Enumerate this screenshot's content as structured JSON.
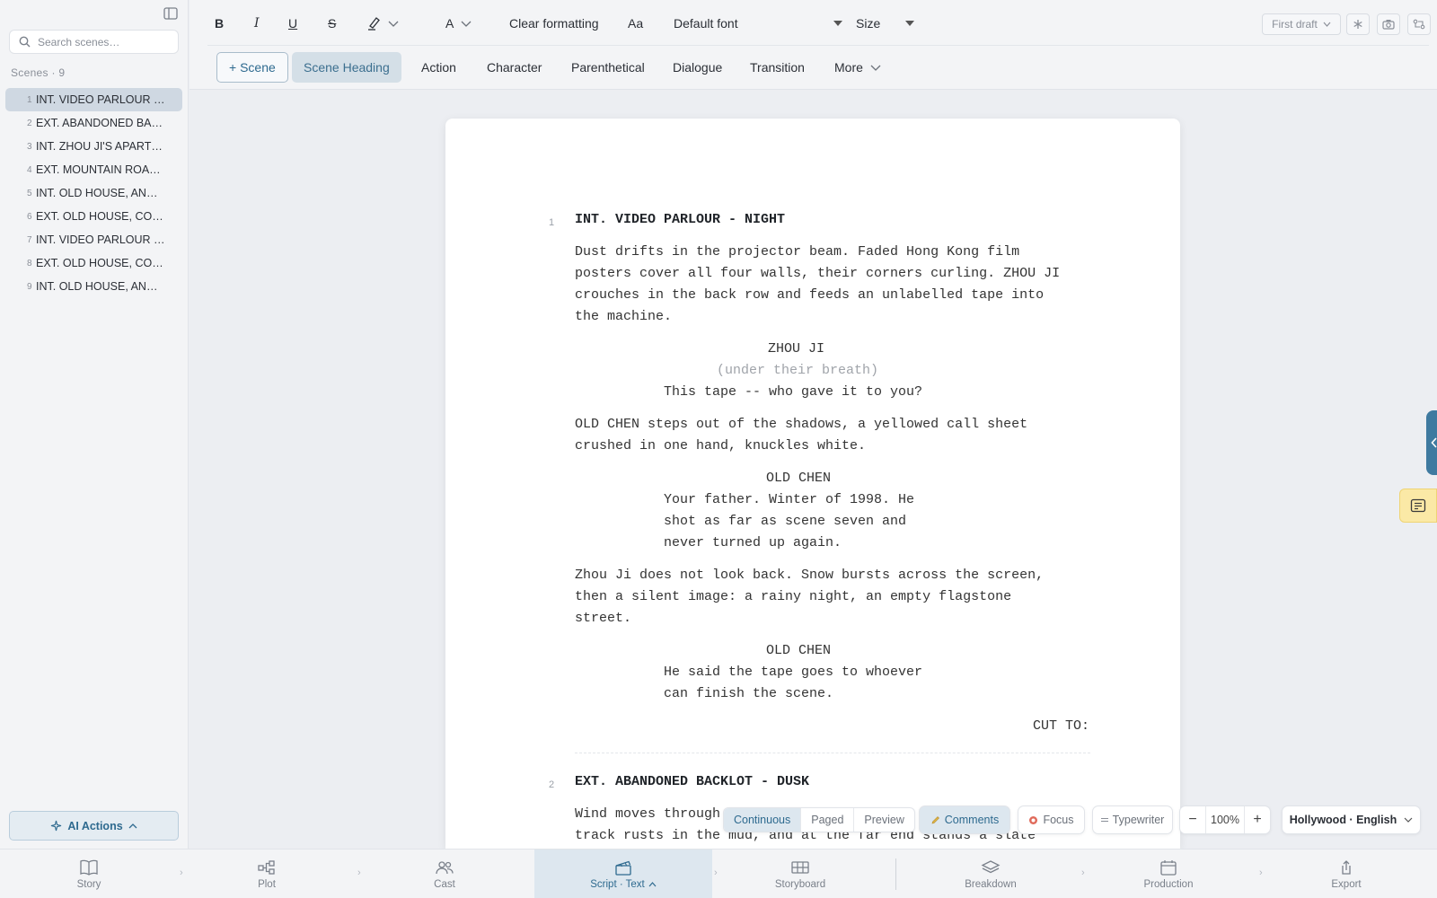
{
  "sidebar": {
    "search_placeholder": "Search scenes…",
    "scenes_header": "Scenes · 9",
    "scenes": [
      {
        "num": "1",
        "label": "INT. VIDEO PARLOUR …"
      },
      {
        "num": "2",
        "label": "EXT. ABANDONED BA…"
      },
      {
        "num": "3",
        "label": "INT. ZHOU JI'S APART…"
      },
      {
        "num": "4",
        "label": "EXT. MOUNTAIN ROA…"
      },
      {
        "num": "5",
        "label": "INT. OLD HOUSE, AN…"
      },
      {
        "num": "6",
        "label": "EXT. OLD HOUSE, CO…"
      },
      {
        "num": "7",
        "label": "INT. VIDEO PARLOUR …"
      },
      {
        "num": "8",
        "label": "EXT. OLD HOUSE, CO…"
      },
      {
        "num": "9",
        "label": "INT. OLD HOUSE, AN…"
      }
    ],
    "ai_actions": "AI Actions"
  },
  "toolbar": {
    "bold": "B",
    "italic": "I",
    "underline": "U",
    "strike": "S",
    "color": "A",
    "clear_formatting": "Clear formatting",
    "case": "Aa",
    "font": "Default font",
    "size": "Size",
    "draft": "First draft",
    "blocks": {
      "scene": "+ Scene",
      "scene_heading": "Scene Heading",
      "action": "Action",
      "character": "Character",
      "parenthetical": "Parenthetical",
      "dialogue": "Dialogue",
      "transition": "Transition",
      "more": "More"
    }
  },
  "script": {
    "s1_num": "1",
    "s1_heading": "INT. VIDEO PARLOUR - NIGHT",
    "a1": [
      "Dust drifts in the projector beam. Faded Hong Kong film",
      "posters cover all four walls, their corners curling. ZHOU JI",
      "crouches in the back row and feeds an unlabelled tape into",
      "the machine."
    ],
    "c1": "ZHOU JI",
    "p1": "(under their breath)",
    "d1": [
      "This tape -- who gave it to you?"
    ],
    "a2": [
      "OLD CHEN steps out of the shadows, a yellowed call sheet",
      "crushed in one hand, knuckles white."
    ],
    "c2": "OLD CHEN",
    "d2": [
      "Your father. Winter of 1998. He",
      "shot as far as scene seven and",
      "never turned up again."
    ],
    "a3": [
      "Zhou Ji does not look back. Snow bursts across the screen,",
      "then a silent image: a rainy night, an empty flagstone",
      "street."
    ],
    "c3": "OLD CHEN",
    "d3": [
      "He said the tape goes to whoever",
      "can finish the scene."
    ],
    "t1": "CUT TO:",
    "s2_num": "2",
    "s2_heading": "EXT. ABANDONED BACKLOT - DUSK",
    "a4": [
      "Wind moves through",
      "track rusts in the mud, and at the far end stands a slate"
    ]
  },
  "viewbar": {
    "continuous": "Continuous",
    "paged": "Paged",
    "preview": "Preview",
    "comments": "Comments",
    "focus": "Focus",
    "typewriter": "Typewriter",
    "zoom": "100%",
    "format": "Hollywood · English"
  },
  "nav": {
    "story": "Story",
    "plot": "Plot",
    "cast": "Cast",
    "script": "Script · Text",
    "storyboard": "Storyboard",
    "breakdown": "Breakdown",
    "production": "Production",
    "export": "Export"
  }
}
